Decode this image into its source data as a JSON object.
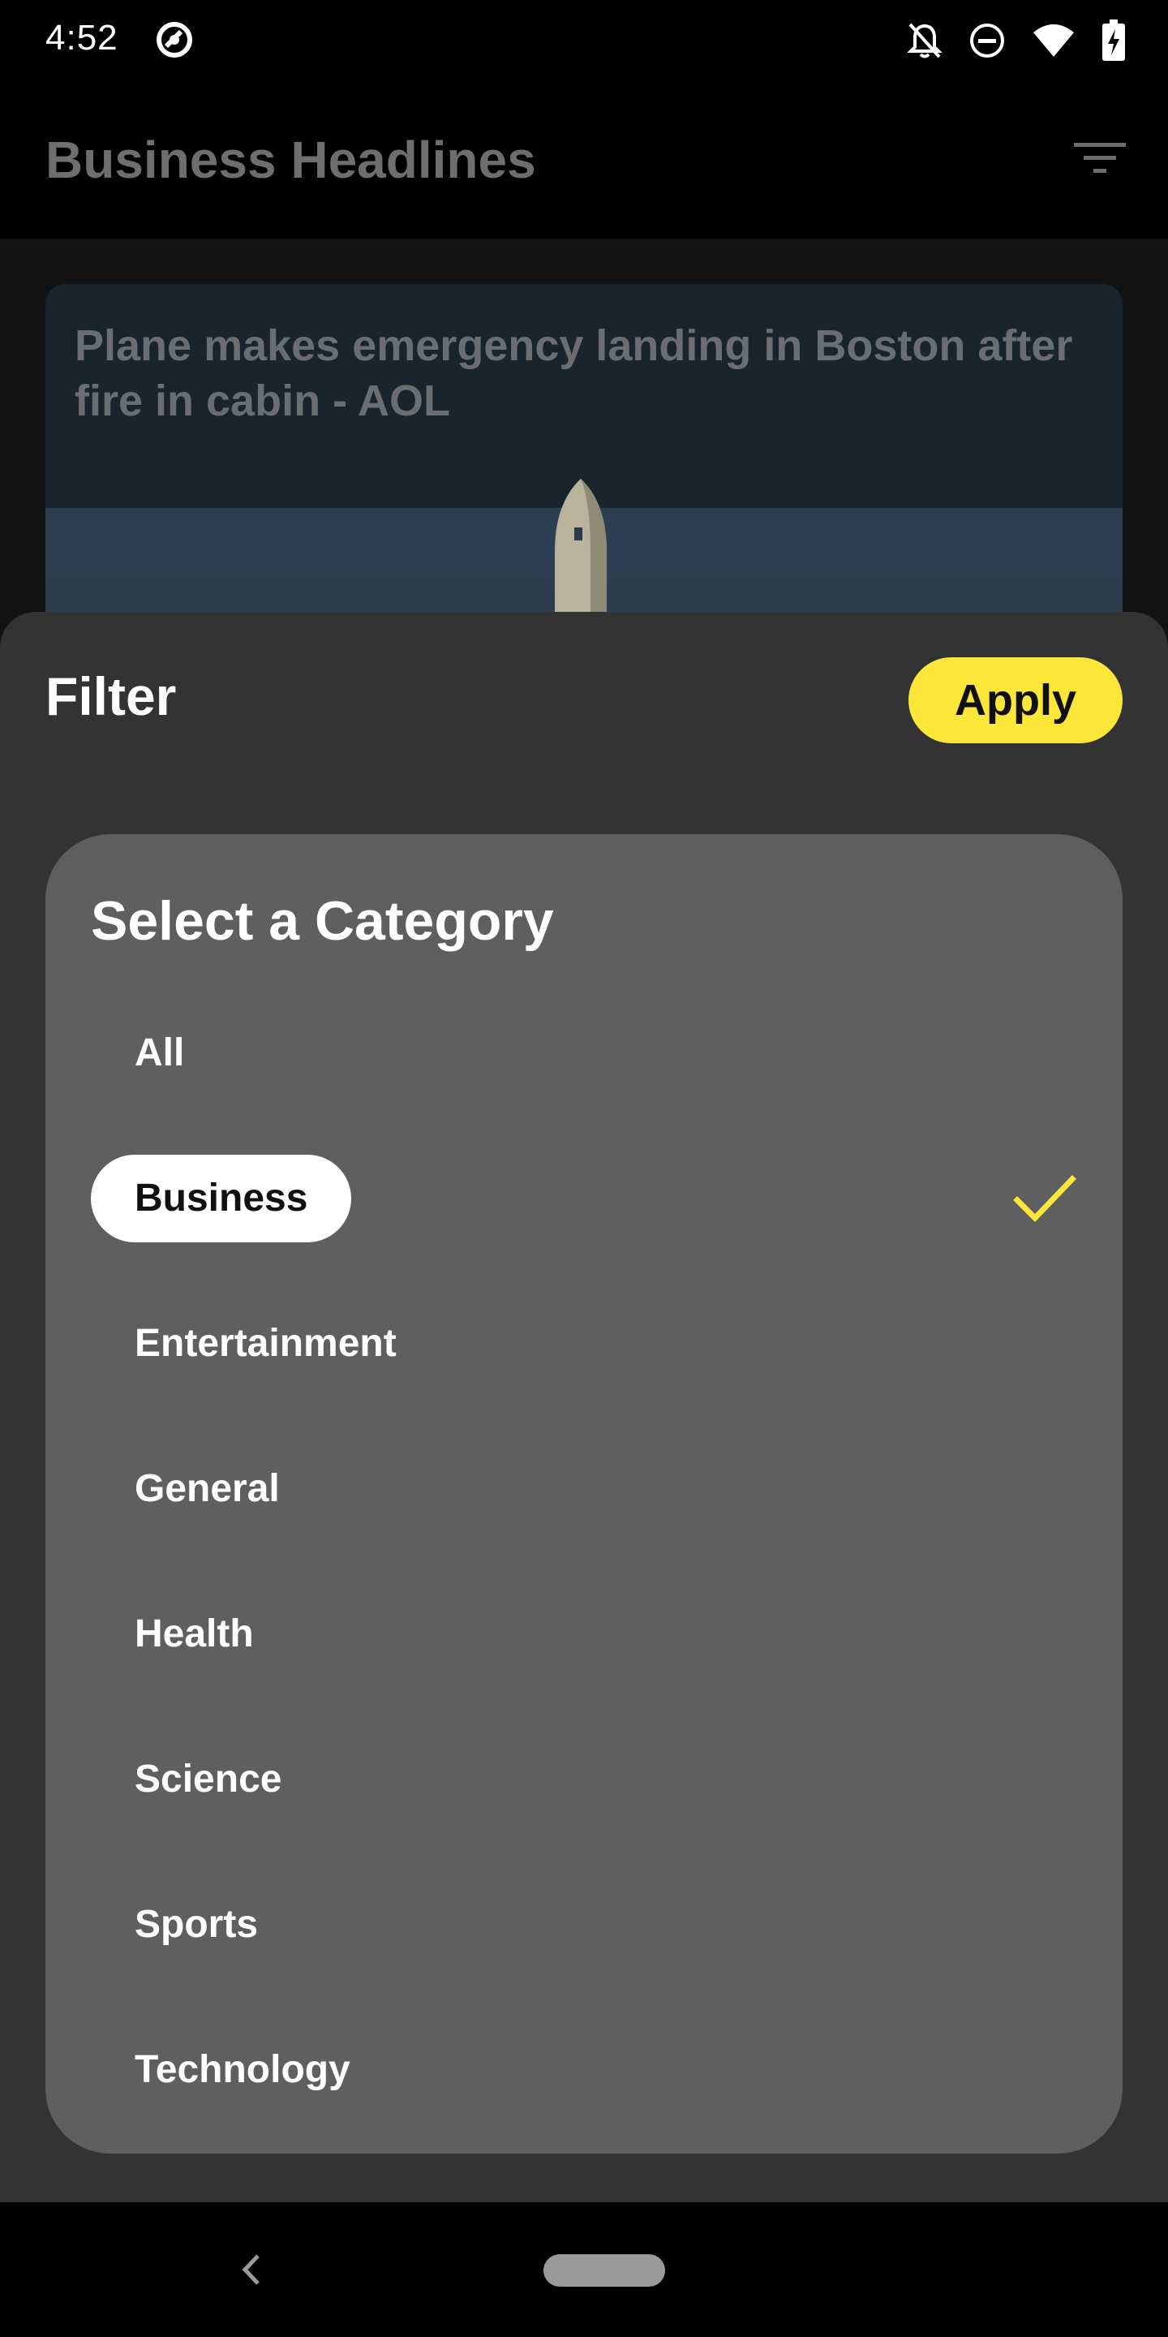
{
  "status_bar": {
    "time": "4:52",
    "icons": [
      "app-notification-icon",
      "do-not-disturb-bell-off-icon",
      "dnd-minus-circle-icon",
      "wifi-icon",
      "battery-charging-icon"
    ]
  },
  "app_bar": {
    "title": "Business Headlines",
    "filter_icon": "filter-icon"
  },
  "article": {
    "title": "Plane makes emergency landing in Boston after fire in cabin - AOL"
  },
  "sheet": {
    "title": "Filter",
    "apply_label": "Apply",
    "category_heading": "Select a Category",
    "categories": [
      {
        "label": "All",
        "selected": false
      },
      {
        "label": "Business",
        "selected": true
      },
      {
        "label": "Entertainment",
        "selected": false
      },
      {
        "label": "General",
        "selected": false
      },
      {
        "label": "Health",
        "selected": false
      },
      {
        "label": "Science",
        "selected": false
      },
      {
        "label": "Sports",
        "selected": false
      },
      {
        "label": "Technology",
        "selected": false
      }
    ]
  },
  "colors": {
    "accent": "#fce63a",
    "sheet_bg": "#333333",
    "card_bg": "#5f5f5f"
  }
}
